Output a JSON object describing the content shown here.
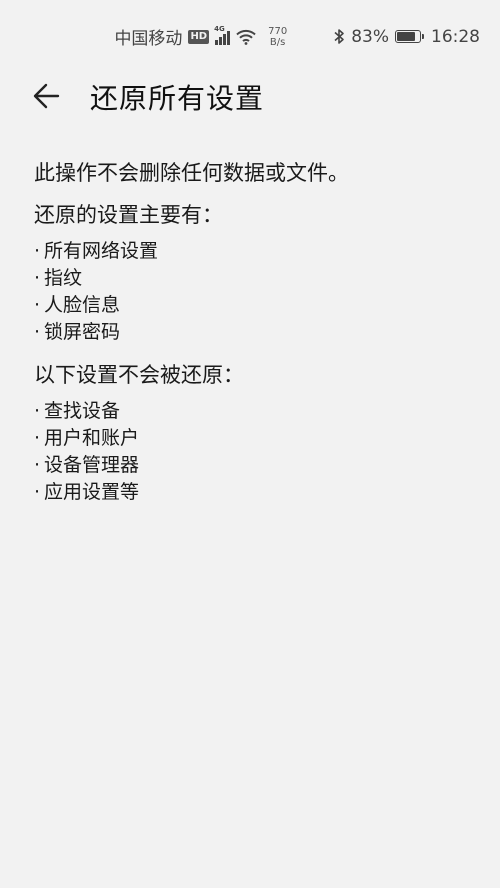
{
  "status_bar": {
    "carrier": "中国移动",
    "hd_label": "HD",
    "network_label": "4G",
    "speed_value": "770",
    "speed_unit": "B/s",
    "bluetooth_icon": "bluetooth-icon",
    "battery_percent": "83%",
    "battery_level": 0.83,
    "time": "16:28"
  },
  "header": {
    "back_icon": "arrow-left-icon",
    "title": "还原所有设置"
  },
  "content": {
    "intro": "此操作不会删除任何数据或文件。",
    "reset_section": {
      "title": "还原的设置主要有：",
      "items": [
        "所有网络设置",
        "指纹",
        "人脸信息",
        "锁屏密码"
      ]
    },
    "keep_section": {
      "title": "以下设置不会被还原：",
      "items": [
        "查找设备",
        "用户和账户",
        "设备管理器",
        "应用设置等"
      ]
    },
    "bullet": "·"
  }
}
